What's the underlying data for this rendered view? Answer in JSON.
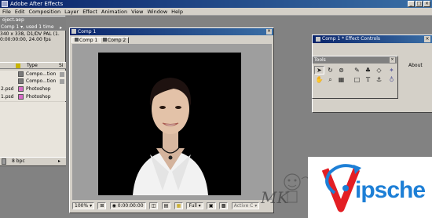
{
  "app": {
    "title": "Adobe After Effects",
    "window_controls": [
      "_",
      "□",
      "×"
    ]
  },
  "menu": [
    "File",
    "Edit",
    "Composition",
    "Layer",
    "Effect",
    "Animation",
    "View",
    "Window",
    "Help"
  ],
  "project_panel": {
    "title": "oject.aep",
    "comp_label": "Comp 1 ▾, used 1 time",
    "info_line1": "340 x 338, D1/DV PAL (1.",
    "info_line2": "0:00:00:00, 24.00 fps",
    "columns": [
      "Type",
      "Si"
    ],
    "rows": [
      {
        "name": "",
        "type": "Compo...tion",
        "color": "#7a7a7a"
      },
      {
        "name": "",
        "type": "Compo...tion",
        "color": "#7a7a7a"
      },
      {
        "name": "2.psd",
        "type": "Photoshop",
        "color": "#d86ac8"
      },
      {
        "name": "1.psd",
        "type": "Photoshop",
        "color": "#d86ac8"
      }
    ],
    "footer_bpc": "8 bpc"
  },
  "comp_window": {
    "title": "Comp 1",
    "tabs": [
      "Comp 1",
      "Comp 2"
    ],
    "zoom": "100%",
    "timecode": "0:00:00:00",
    "resolution": "Full",
    "camera": "Active C"
  },
  "effect_controls": {
    "title": "Comp 1 * Effect Controls",
    "about_label": "About"
  },
  "tools": {
    "title": "Tools",
    "icons": [
      "arrow-tool-icon",
      "rotate-tool-icon",
      "orbit-camera-icon",
      "pen-tool-icon",
      "brush-tool-icon",
      "clone-stamp-icon",
      "eraser-icon",
      "hand-tool-icon",
      "zoom-tool-icon",
      "pan-behind-icon",
      "mask-rect-icon",
      "text-tool-icon",
      "puppet-tool-icon",
      "star-tool-icon"
    ]
  },
  "watermark": {
    "mk_text": "MK",
    "brand": "ipsche"
  },
  "colors": {
    "title_bar": "#0a246a",
    "panel_gray": "#d4d0c8",
    "workspace": "#828282",
    "comp_bg": "#000000",
    "brand_blue": "#1d7fd6",
    "brand_red": "#e31e24"
  }
}
